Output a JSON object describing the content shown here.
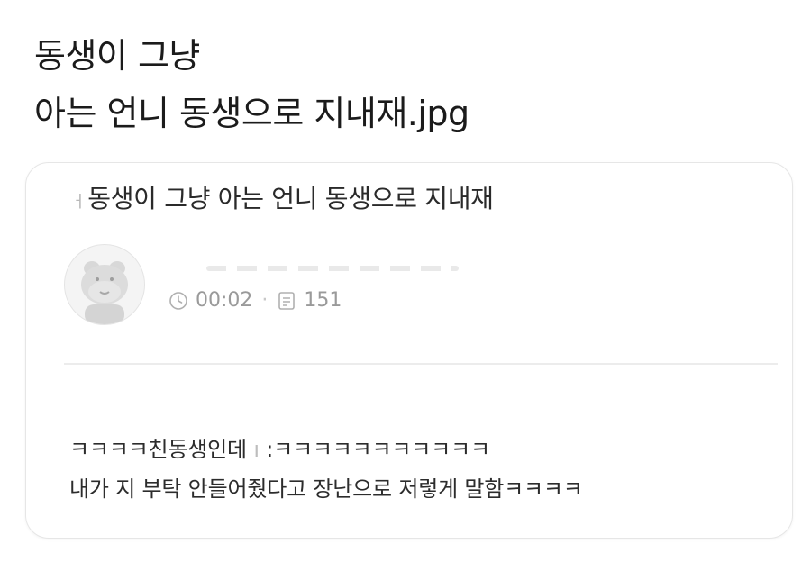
{
  "headline": {
    "line1": "동생이 그냥",
    "line2": "아는 언니 동생으로 지내재.jpg"
  },
  "post": {
    "title_cut": "ㅓ",
    "title": "동생이 그냥 아는 언니 동생으로 지내재",
    "time": "00:02",
    "meta_separator": "·",
    "views": "151",
    "body_line1_a": "ㅋㅋㅋㅋ친동생인데 ",
    "body_line1_cut": "ı",
    "body_line1_b": "  :ㅋㅋㅋㅋㅋㅋㅋㅋㅋㅋㅋ",
    "body_line2": "내가 지 부탁 안들어줬다고 장난으로 저렇게 말함ㅋㅋㅋㅋ"
  },
  "icons": {
    "time": "clock-icon",
    "views": "document-icon",
    "avatar": "hippo-avatar"
  }
}
